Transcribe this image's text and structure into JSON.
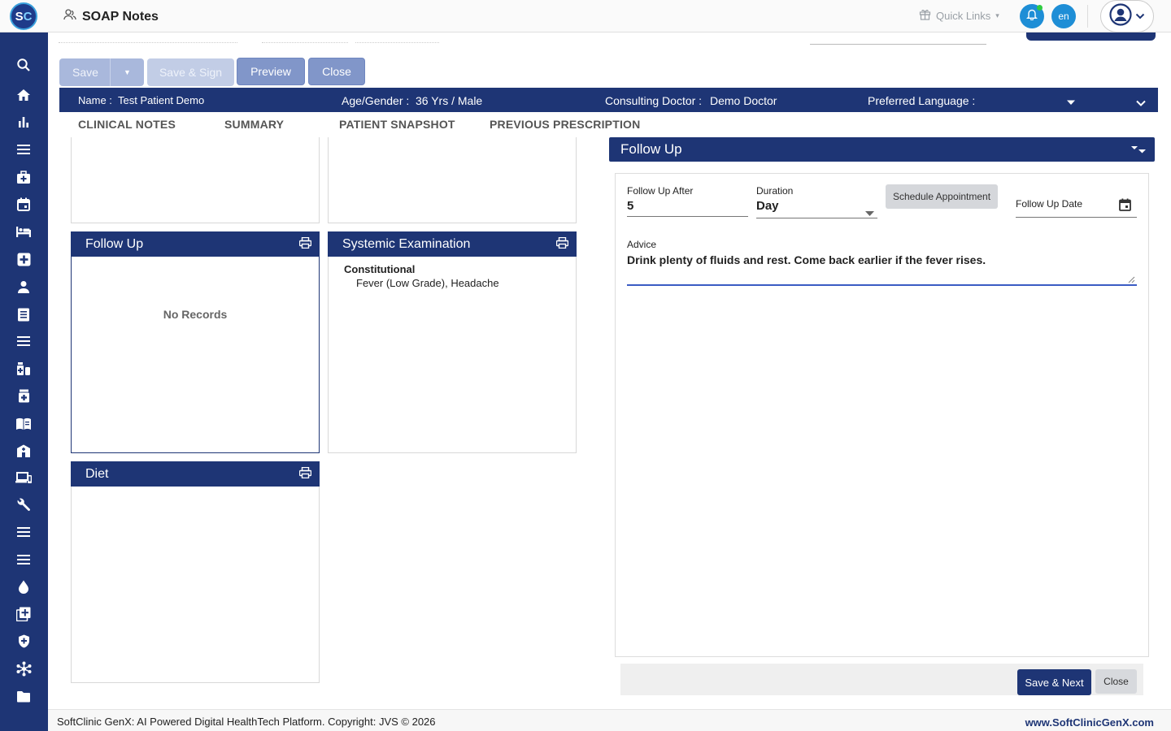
{
  "header": {
    "logo_text_s": "S",
    "logo_text_c": "C",
    "page_title": "SOAP Notes",
    "quick_links_label": "Quick Links",
    "language": "en"
  },
  "sidebar": {
    "icons": [
      "search-icon",
      "home-icon",
      "bar-chart-icon",
      "menu-icon",
      "medical-bag-icon",
      "calendar-icon",
      "bed-icon",
      "medical-plus-icon",
      "person-icon",
      "document-icon",
      "list-icon",
      "pharmacy-icon",
      "medicine-box-icon",
      "book-icon",
      "hospital-icon",
      "devices-icon",
      "wrench-icon",
      "list-icon",
      "list-icon",
      "blood-drop-icon",
      "add-box-icon",
      "shield-icon",
      "hub-icon",
      "folder-icon"
    ]
  },
  "toolbar": {
    "save_label": "Save",
    "save_sign_label": "Save & Sign",
    "preview_label": "Preview",
    "close_label": "Close"
  },
  "patient": {
    "name_label": "Name :",
    "name_value": "Test Patient Demo",
    "age_gender_label": "Age/Gender :",
    "age_gender_value": "36 Yrs / Male",
    "doctor_label": "Consulting Doctor :",
    "doctor_value": "Demo Doctor",
    "language_label": "Preferred Language :"
  },
  "tabs": [
    "CLINICAL NOTES",
    "SUMMARY",
    "PATIENT SNAPSHOT",
    "PREVIOUS PRESCRIPTION"
  ],
  "cards": {
    "follow_up": {
      "title": "Follow Up",
      "empty_text": "No Records"
    },
    "systemic": {
      "title": "Systemic Examination",
      "section": "Constitutional",
      "findings": "Fever (Low Grade), Headache"
    },
    "diet": {
      "title": "Diet"
    }
  },
  "follow_up_panel": {
    "title": "Follow Up",
    "after_label": "Follow Up After",
    "after_value": "5",
    "duration_label": "Duration",
    "duration_value": "Day",
    "schedule_label": "Schedule Appointment",
    "date_label": "Follow Up Date",
    "advice_label": "Advice",
    "advice_value": "Drink plenty of fluids and rest. Come back earlier if the fever rises.",
    "save_next_label": "Save & Next",
    "close_label": "Close"
  },
  "footer": {
    "copyright": "SoftClinic GenX: AI Powered Digital HealthTech Platform. Copyright: JVS © 2026",
    "website": "www.SoftClinicGenX.com"
  },
  "colors": {
    "primary": "#1e3575",
    "accent": "#1e8ed6",
    "muted_button": "#a9b8dc"
  }
}
